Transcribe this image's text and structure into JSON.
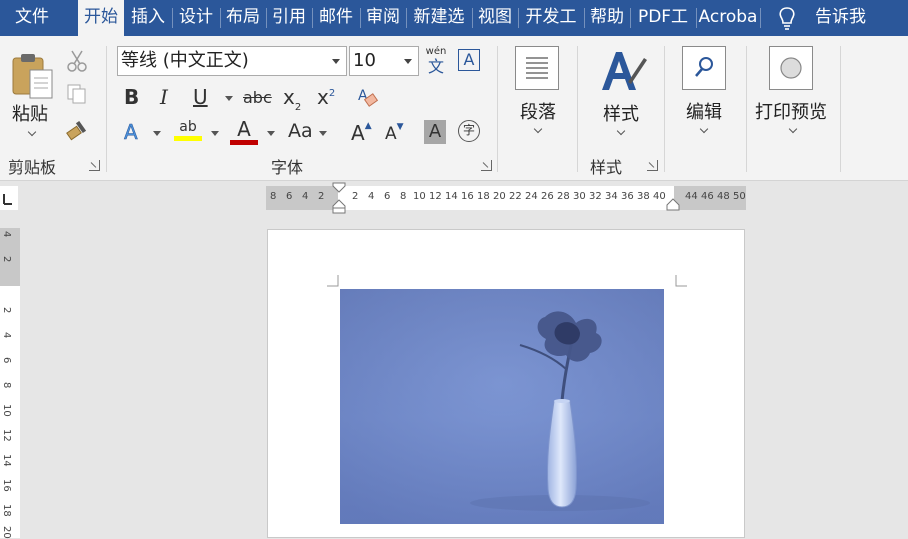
{
  "menu": {
    "tabs": [
      {
        "label": "文件"
      },
      {
        "label": "开始"
      },
      {
        "label": "插入"
      },
      {
        "label": "设计"
      },
      {
        "label": "布局"
      },
      {
        "label": "引用"
      },
      {
        "label": "邮件"
      },
      {
        "label": "审阅"
      },
      {
        "label": "新建选"
      },
      {
        "label": "视图"
      },
      {
        "label": "开发工"
      },
      {
        "label": "帮助"
      },
      {
        "label": "PDF工"
      },
      {
        "label": "Acroba"
      }
    ],
    "active_tab": "开始",
    "tell_me": "告诉我"
  },
  "clipboard": {
    "paste_label": "粘贴",
    "group_label": "剪贴板"
  },
  "font": {
    "font_name": "等线 (中文正文)",
    "font_size": "10",
    "phonetic_top": "wén",
    "phonetic_bottom": "文",
    "border_char": "A",
    "bold": "B",
    "italic": "I",
    "underline": "U",
    "strike": "abc",
    "subscript": "x",
    "subscript_mark": "2",
    "superscript": "x",
    "superscript_mark": "2",
    "text_effect": "A",
    "highlight": "ab",
    "font_color": "A",
    "change_case": "Aa",
    "grow": "A",
    "shrink": "A",
    "shading": "A",
    "enclose": "字",
    "group_label": "字体"
  },
  "paragraph": {
    "label": "段落"
  },
  "styles": {
    "label": "样式",
    "group_label": "样式"
  },
  "editing": {
    "label": "编辑"
  },
  "print_preview": {
    "label": "打印预览"
  },
  "hruler": {
    "left_labels": [
      "8",
      "6",
      "4",
      "2"
    ],
    "right_labels": [
      "2",
      "4",
      "6",
      "8",
      "10",
      "12",
      "14",
      "16",
      "18",
      "20",
      "22",
      "24",
      "26",
      "28",
      "30",
      "32",
      "34",
      "36",
      "38",
      "40"
    ],
    "margin_labels": [
      "44",
      "46",
      "48",
      "50"
    ]
  },
  "vruler": {
    "top_labels": [
      "4",
      "2"
    ],
    "labels": [
      "2",
      "4",
      "6",
      "8",
      "10",
      "12",
      "14",
      "16",
      "18",
      "20"
    ]
  },
  "colors": {
    "brand": "#2b579a",
    "highlight": "#ffff00",
    "font_color": "#c00000"
  }
}
